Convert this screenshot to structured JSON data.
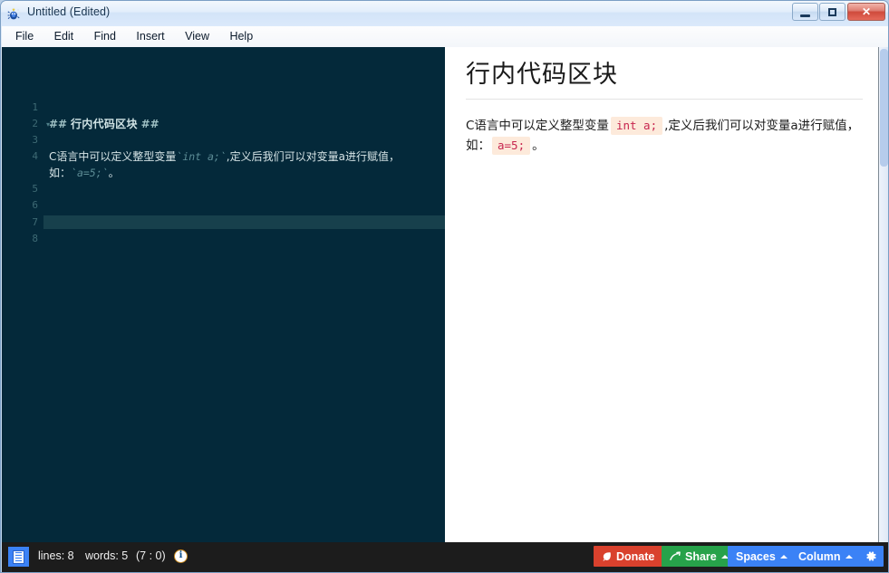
{
  "window": {
    "title": "Untitled (Edited)",
    "icon": "app-bug-icon",
    "controls": {
      "minimize": "minimize-icon",
      "maximize": "maximize-icon",
      "close": "✕"
    }
  },
  "menubar": {
    "items": [
      {
        "label": "File"
      },
      {
        "label": "Edit"
      },
      {
        "label": "Find"
      },
      {
        "label": "Insert"
      },
      {
        "label": "View"
      },
      {
        "label": "Help"
      }
    ]
  },
  "editor": {
    "theme_background": "#04293a",
    "current_line": 7,
    "gutter_numbers": [
      "1",
      "2",
      "3",
      "4",
      "5",
      "6",
      "7",
      "8"
    ],
    "fold_marker_line": 2,
    "lines": [
      {
        "number": 1,
        "type": "blank",
        "text": ""
      },
      {
        "number": 2,
        "type": "heading",
        "prefix": "##",
        "text": "行内代码区块",
        "suffix": "##"
      },
      {
        "number": 3,
        "type": "blank",
        "text": ""
      },
      {
        "number": 4,
        "type": "paragraph",
        "segments": [
          {
            "kind": "text",
            "text": "C语言中可以定义整型变量"
          },
          {
            "kind": "code",
            "text": "`int a;`"
          },
          {
            "kind": "text",
            "text": ",定义后我们可以对变量a进行赋值，"
          }
        ]
      },
      {
        "number": 4,
        "type": "paragraph-wrap",
        "segments": [
          {
            "kind": "text",
            "text": "如："
          },
          {
            "kind": "code",
            "text": "`a=5;`"
          },
          {
            "kind": "text",
            "text": "。"
          }
        ]
      },
      {
        "number": 5,
        "type": "blank",
        "text": ""
      },
      {
        "number": 6,
        "type": "blank",
        "text": ""
      },
      {
        "number": 7,
        "type": "blank",
        "text": ""
      },
      {
        "number": 8,
        "type": "blank",
        "text": ""
      }
    ]
  },
  "preview": {
    "heading": "行内代码区块",
    "paragraph": {
      "part1": "C语言中可以定义整型变量",
      "code1": "int a;",
      "part2": ",定义后我们可以对变量a进行赋值，如：",
      "code2": "a=5;",
      "part3": "。"
    },
    "code_background": "#fdeadb",
    "code_color": "#c7254e"
  },
  "statusbar": {
    "doc_icon": "document-icon",
    "lines": "lines: 8",
    "words": "words: 5",
    "position": "(7 : 0)",
    "info_icon": "i",
    "buttons": [
      {
        "name": "donate",
        "label": "Donate",
        "icon": "leaf-icon",
        "color": "#d9412d",
        "caret": false
      },
      {
        "name": "share",
        "label": "Share",
        "icon": "arrow-icon",
        "color": "#27a24a",
        "caret": true
      },
      {
        "name": "spaces",
        "label": "Spaces",
        "icon": "",
        "color": "#3b82f6",
        "caret": true
      },
      {
        "name": "column",
        "label": "Column",
        "icon": "",
        "color": "#3b82f6",
        "caret": true
      },
      {
        "name": "settings",
        "label": "⚙",
        "icon": "gear-icon",
        "color": "#3b82f6",
        "caret": false
      }
    ]
  }
}
